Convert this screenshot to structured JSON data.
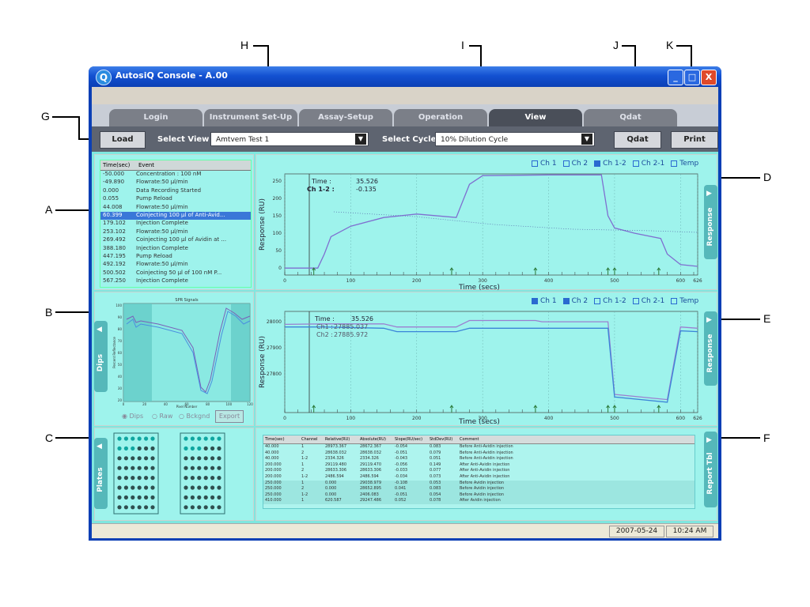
{
  "window": {
    "title": "AutosiQ Console - A.00",
    "app_icon": "Q",
    "min": "_",
    "max": "□",
    "close": "X"
  },
  "tabs": [
    "Login",
    "Instrument Set-Up",
    "Assay-Setup",
    "Operation",
    "View",
    "Qdat"
  ],
  "active_tab": "View",
  "toolbar": {
    "load": "Load",
    "select_view_label": "Select  View",
    "select_view_value": "Amtvem Test 1",
    "select_cycle_label": "Select  Cycle",
    "select_cycle_value": "10% Dilution Cycle",
    "qdat": "Qdat",
    "print": "Print"
  },
  "callouts": [
    "A",
    "B",
    "C",
    "D",
    "E",
    "F",
    "G",
    "H",
    "I",
    "J",
    "K"
  ],
  "event_table": {
    "headers": [
      "Time(sec)",
      "Event"
    ],
    "rows": [
      [
        "-50.000",
        "Concentration : 100 nM"
      ],
      [
        "-49.890",
        "Flowrate:50 µl/min"
      ],
      [
        "0.000",
        "Data Recording Started"
      ],
      [
        "0.055",
        "Pump Reload"
      ],
      [
        "44.008",
        "Flowrate:50 µl/min"
      ],
      [
        "60.399",
        "Coinjecting 100 µl of Anti-Avid..."
      ],
      [
        "179.102",
        "Injection Complete"
      ],
      [
        "253.102",
        "Flowrate:50 µl/min"
      ],
      [
        "269.492",
        "Coinjecting 100 µl of Avidin at ..."
      ],
      [
        "388.180",
        "Injection Complete"
      ],
      [
        "447.195",
        "Pump Reload"
      ],
      [
        "492.192",
        "Flowrate:50 µl/min"
      ],
      [
        "500.502",
        "Coinjecting 50 µl of 100 nM P..."
      ],
      [
        "567.250",
        "Injection Complete"
      ]
    ],
    "selected_row": 5
  },
  "dips": {
    "tab": "Dips",
    "plot_title": "SPR Signals",
    "xlabel": "Pixel Number",
    "ylabel": "Percent Reflectance",
    "radios": [
      "Dips",
      "Raw",
      "Bckgnd"
    ],
    "selected_radio": "Dips",
    "export": "Export",
    "xticks": [
      "0",
      "20",
      "40",
      "60",
      "80",
      "100",
      "120"
    ],
    "yticks": [
      "100",
      "90",
      "80",
      "70",
      "60",
      "50",
      "40",
      "30",
      "20"
    ]
  },
  "plates": {
    "tab": "Plates",
    "rows": 8,
    "cols": 6
  },
  "chart_top": {
    "tab": "Response",
    "legend": [
      "Ch 1",
      "Ch 2",
      "Ch 1-2",
      "Ch 2-1",
      "Temp"
    ],
    "legend_filled": [
      false,
      false,
      true,
      false,
      false
    ],
    "readout": {
      "time_label": "Time :",
      "time_value": "35.526",
      "ch_label": "Ch 1-2 :",
      "ch_value": "-0.135"
    },
    "xlabel": "Time (secs)",
    "ylabel": "Response (RU)",
    "xticks": [
      "0",
      "100",
      "200",
      "300",
      "400",
      "500",
      "600",
      "626"
    ],
    "yticks": [
      "250",
      "200",
      "150",
      "100",
      "50",
      "0"
    ]
  },
  "chart_bottom": {
    "tab": "Response",
    "legend": [
      "Ch 1",
      "Ch 2",
      "Ch 1-2",
      "Ch 2-1",
      "Temp"
    ],
    "legend_filled": [
      true,
      true,
      false,
      false,
      false
    ],
    "readout": {
      "time_label": "Time :",
      "time_value": "35.526",
      "ch1_label": "Ch1 :",
      "ch1_value": "27885.037",
      "ch2_label": "Ch2 :",
      "ch2_value": "27885.972"
    },
    "xlabel": "Time (secs)",
    "ylabel": "Response (RU)",
    "xticks": [
      "0",
      "100",
      "200",
      "300",
      "400",
      "500",
      "600",
      "626"
    ],
    "yticks": [
      "28000",
      "27900",
      "27800"
    ]
  },
  "chart_data": [
    {
      "type": "line",
      "title": "",
      "xlabel": "Time (secs)",
      "ylabel": "Response (RU)",
      "xlim": [
        0,
        626
      ],
      "ylim": [
        -20,
        270
      ],
      "series": [
        {
          "name": "Ch 1-2",
          "x": [
            0,
            30,
            50,
            60,
            70,
            100,
            150,
            200,
            260,
            280,
            300,
            400,
            480,
            490,
            500,
            530,
            570,
            580,
            600,
            626
          ],
          "y": [
            0,
            0,
            0,
            40,
            90,
            120,
            145,
            155,
            145,
            240,
            265,
            267,
            267,
            150,
            115,
            100,
            85,
            40,
            10,
            5
          ]
        }
      ]
    },
    {
      "type": "line",
      "title": "",
      "xlabel": "Time (secs)",
      "ylabel": "Response (RU)",
      "xlim": [
        0,
        626
      ],
      "ylim": [
        27650,
        28040
      ],
      "series": [
        {
          "name": "Ch 1",
          "x": [
            0,
            60,
            150,
            170,
            260,
            280,
            380,
            390,
            490,
            500,
            580,
            600,
            626
          ],
          "y": [
            27990,
            27992,
            27992,
            27980,
            27980,
            28005,
            28005,
            28000,
            28000,
            27720,
            27700,
            27980,
            27975
          ]
        },
        {
          "name": "Ch 2",
          "x": [
            0,
            60,
            150,
            170,
            260,
            280,
            380,
            390,
            490,
            500,
            580,
            600,
            626
          ],
          "y": [
            27980,
            27980,
            27975,
            27962,
            27962,
            27975,
            27975,
            27975,
            27975,
            27710,
            27690,
            27965,
            27962
          ]
        }
      ]
    }
  ],
  "report": {
    "tab": "Report Tbl",
    "headers": [
      "Time(sec)",
      "Channel",
      "Relative(RU)",
      "Absolute(RU)",
      "Slope(RU/sec)",
      "StdDev(RU)",
      "Comment"
    ],
    "rows": [
      [
        "40.000",
        "1",
        "28973.367",
        "28672.367",
        "-0.054",
        "0.083",
        "Before Anti-Avidin injection"
      ],
      [
        "40.000",
        "2",
        "28638.032",
        "28638.032",
        "-0.051",
        "0.079",
        "Before Anti-Avidin injection"
      ],
      [
        "40.000",
        "1-2",
        "2334.326",
        "2334.326",
        "-0.043",
        "0.051",
        "Before Anti-Avidin injection"
      ],
      [
        "200.000",
        "1",
        "29119.480",
        "29119.470",
        "-0.056",
        "0.149",
        "After Anti-Avidin injection"
      ],
      [
        "200.000",
        "2",
        "28633.306",
        "28633.306",
        "-0.033",
        "0.077",
        "After Anti-Avidin injection"
      ],
      [
        "200.000",
        "1-2",
        "2486.594",
        "2486.594",
        "-0.034",
        "0.073",
        "After Anti-Avidin injection"
      ],
      [
        "250.000",
        "1",
        "0.000",
        "29038.979",
        "-0.108",
        "0.053",
        "Before Avidin injection"
      ],
      [
        "250.000",
        "2",
        "0.000",
        "28652.895",
        "0.041",
        "0.083",
        "Before Avidin injection"
      ],
      [
        "250.000",
        "1-2",
        "0.000",
        "2406.083",
        "-0.051",
        "0.054",
        "Before Avidin injection"
      ],
      [
        "410.000",
        "1",
        "620.587",
        "29247.486",
        "0.052",
        "0.078",
        "After Avidin injection"
      ]
    ]
  },
  "status": {
    "date": "2007-05-24",
    "time": "10:24 AM"
  }
}
